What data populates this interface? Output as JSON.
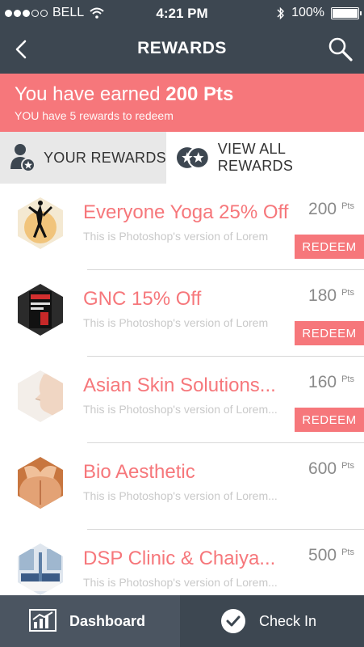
{
  "status_bar": {
    "carrier": "BELL",
    "time": "4:21 PM",
    "battery": "100%",
    "icons": [
      "signal-dots-icon",
      "wifi-icon",
      "bluetooth-icon",
      "battery-icon"
    ]
  },
  "nav": {
    "title": "REWARDS",
    "icons": [
      "back-chevron-icon",
      "search-icon"
    ]
  },
  "banner": {
    "earned_prefix": "You have earned",
    "earned_value": "200 Pts",
    "subtitle": "YOU have 5 rewards to redeem"
  },
  "tabs": [
    {
      "label": "YOUR REWARDS",
      "icon": "user-star-icon",
      "active": true
    },
    {
      "label": "VIEW ALL REWARDS",
      "icon": "stars-icon",
      "active": false
    }
  ],
  "rewards": [
    {
      "name": "Everyone Yoga 25% Off",
      "desc": "This is Photoshop's version  of Lorem",
      "points": "200",
      "unit": "Pts",
      "action": "REDEEM",
      "thumb": "yoga-photo"
    },
    {
      "name": "GNC 15% Off",
      "desc": "This is Photoshop's version  of Lorem",
      "points": "180",
      "unit": "Pts",
      "action": "REDEEM",
      "thumb": "supplement-photo"
    },
    {
      "name": "Asian Skin Solutions...",
      "desc": "This is Photoshop's version  of Lorem...",
      "points": "160",
      "unit": "Pts",
      "action": "REDEEM",
      "thumb": "skin-photo"
    },
    {
      "name": "Bio Aesthetic",
      "desc": "This is Photoshop's version  of Lorem...",
      "points": "600",
      "unit": "Pts",
      "thumb": "back-massage-photo"
    },
    {
      "name": "DSP Clinic & Chaiya...",
      "desc": "This is Photoshop's version  of Lorem...",
      "points": "500",
      "unit": "Pts",
      "thumb": "clinic-photo"
    }
  ],
  "bottom_bar": {
    "dashboard_label": "Dashboard",
    "checkin_label": "Check In"
  },
  "colors": {
    "header": "#3d4751",
    "accent": "#f6777b",
    "tab_active_bg": "#e8e8e8",
    "bottom_dashboard": "#4b5561",
    "bottom_checkin": "#3d4751"
  }
}
